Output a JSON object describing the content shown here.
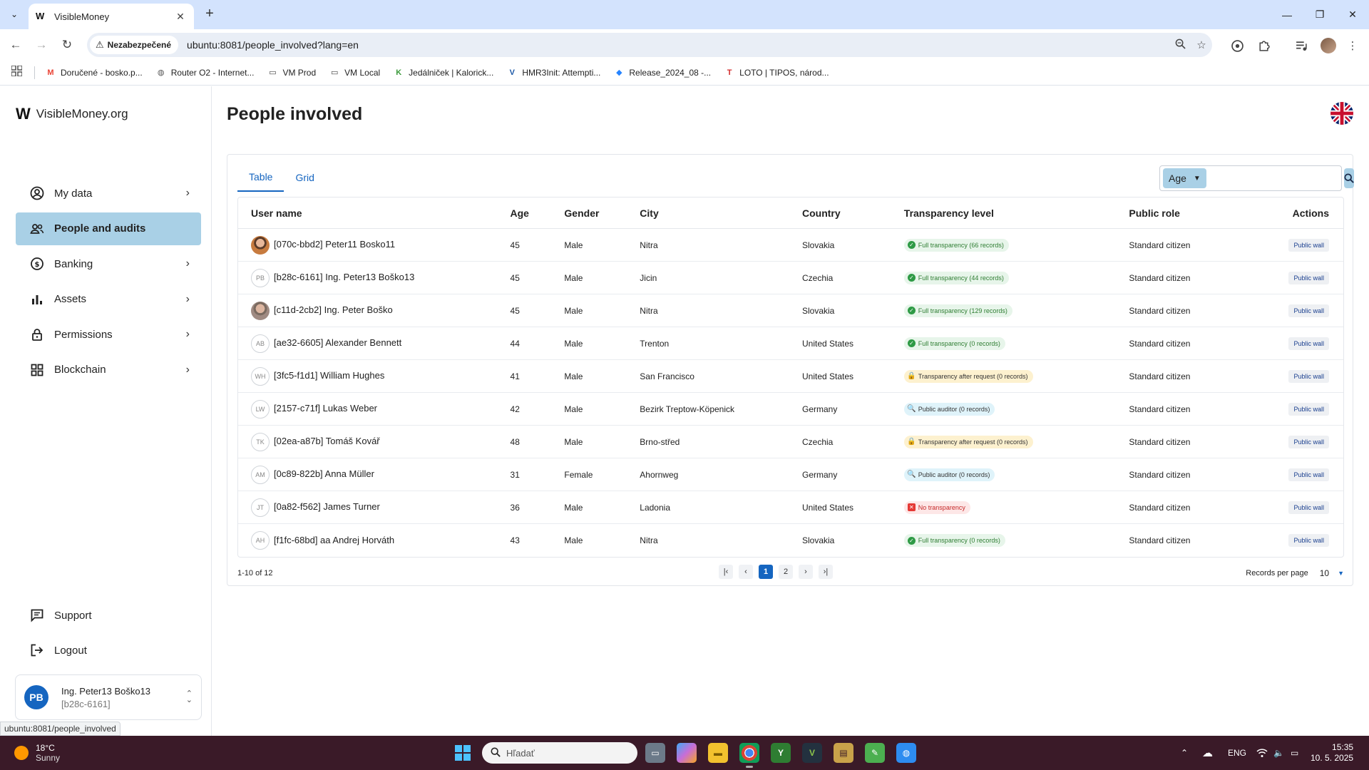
{
  "browser": {
    "tab_title": "VisibleMoney",
    "security_label": "Nezabezpečené",
    "url": "ubuntu:8081/people_involved?lang=en",
    "status_url": "ubuntu:8081/people_involved",
    "bookmarks": [
      {
        "label": "Doručené - bosko.p...",
        "icon": "gmail-icon",
        "color": "#ea4335"
      },
      {
        "label": "Router O2 - Internet...",
        "icon": "globe-icon",
        "color": "#555555"
      },
      {
        "label": "VM Prod",
        "icon": "folder-icon",
        "color": "#444444"
      },
      {
        "label": "VM Local",
        "icon": "folder-icon",
        "color": "#444444"
      },
      {
        "label": "Jedálniček | Kalorick...",
        "icon": "kaloricke-icon",
        "color": "#3c9a3c"
      },
      {
        "label": "HMR3Init: Attempti...",
        "icon": "virtualbox-icon",
        "color": "#1e5aa8"
      },
      {
        "label": "Release_2024_08 -...",
        "icon": "jira-icon",
        "color": "#2684ff"
      },
      {
        "label": "LOTO | TIPOS, národ...",
        "icon": "tipos-icon",
        "color": "#d32f2f"
      }
    ]
  },
  "app": {
    "brand": "VisibleMoney.org",
    "page_title": "People involved",
    "accent": "#1565c0",
    "active_bg": "#a9d0e6",
    "nav": [
      {
        "label": "My data",
        "icon": "account-circle-icon",
        "chevron": true
      },
      {
        "label": "People and audits",
        "icon": "people-icon",
        "chevron": false
      },
      {
        "label": "Banking",
        "icon": "banking-icon",
        "chevron": true
      },
      {
        "label": "Assets",
        "icon": "bar-chart-icon",
        "chevron": true
      },
      {
        "label": "Permissions",
        "icon": "lock-icon",
        "chevron": true
      },
      {
        "label": "Blockchain",
        "icon": "grid-icon",
        "chevron": true
      }
    ],
    "bottom_nav": [
      {
        "label": "Support",
        "icon": "support-chat-icon"
      },
      {
        "label": "Logout",
        "icon": "logout-icon"
      }
    ],
    "user": {
      "initials": "PB",
      "name": "Ing. Peter13 Boško13",
      "id": "[b28c-6161]"
    }
  },
  "view_tabs": [
    "Table",
    "Grid"
  ],
  "search": {
    "filter_field": "Age",
    "value": ""
  },
  "table": {
    "headers": [
      "User name",
      "Age",
      "Gender",
      "City",
      "Country",
      "Transparency level",
      "Public role",
      "Actions"
    ],
    "rows": [
      {
        "avatar": "photo1",
        "name": "[070c-bbd2] Peter11 Bosko11",
        "age": "45",
        "gender": "Male",
        "city": "Nitra",
        "country": "Slovakia",
        "badge_type": "full",
        "badge": "Full transparency (66 records)",
        "role": "Standard citizen",
        "action": "Public wall"
      },
      {
        "avatar": "PB",
        "name": "[b28c-6161] Ing. Peter13 Boško13",
        "age": "45",
        "gender": "Male",
        "city": "Jicin",
        "country": "Czechia",
        "badge_type": "full",
        "badge": "Full transparency (44 records)",
        "role": "Standard citizen",
        "action": "Public wall"
      },
      {
        "avatar": "photo2",
        "name": "[c11d-2cb2] Ing. Peter Boško",
        "age": "45",
        "gender": "Male",
        "city": "Nitra",
        "country": "Slovakia",
        "badge_type": "full",
        "badge": "Full transparency (129 records)",
        "role": "Standard citizen",
        "action": "Public wall"
      },
      {
        "avatar": "AB",
        "name": "[ae32-6605] Alexander Bennett",
        "age": "44",
        "gender": "Male",
        "city": "Trenton",
        "country": "United States",
        "badge_type": "full",
        "badge": "Full transparency (0 records)",
        "role": "Standard citizen",
        "action": "Public wall"
      },
      {
        "avatar": "WH",
        "name": "[3fc5-f1d1] William Hughes",
        "age": "41",
        "gender": "Male",
        "city": "San Francisco",
        "country": "United States",
        "badge_type": "request",
        "badge": "Transparency after request (0 records)",
        "role": "Standard citizen",
        "action": "Public wall"
      },
      {
        "avatar": "LW",
        "name": "[2157-c71f] Lukas Weber",
        "age": "42",
        "gender": "Male",
        "city": "Bezirk Treptow-Köpenick",
        "country": "Germany",
        "badge_type": "auditor",
        "badge": "Public auditor (0 records)",
        "role": "Standard citizen",
        "action": "Public wall"
      },
      {
        "avatar": "TK",
        "name": "[02ea-a87b] Tomáš Kovář",
        "age": "48",
        "gender": "Male",
        "city": "Brno-střed",
        "country": "Czechia",
        "badge_type": "request",
        "badge": "Transparency after request (0 records)",
        "role": "Standard citizen",
        "action": "Public wall"
      },
      {
        "avatar": "AM",
        "name": "[0c89-822b] Anna Müller",
        "age": "31",
        "gender": "Female",
        "city": "Ahornweg",
        "country": "Germany",
        "badge_type": "auditor",
        "badge": "Public auditor (0 records)",
        "role": "Standard citizen",
        "action": "Public wall"
      },
      {
        "avatar": "JT",
        "name": "[0a82-f562] James Turner",
        "age": "36",
        "gender": "Male",
        "city": "Ladonia",
        "country": "United States",
        "badge_type": "none",
        "badge": "No transparency",
        "role": "Standard citizen",
        "action": "Public wall"
      },
      {
        "avatar": "AH",
        "name": "[f1fc-68bd] aa Andrej Horváth",
        "age": "43",
        "gender": "Male",
        "city": "Nitra",
        "country": "Slovakia",
        "badge_type": "full",
        "badge": "Full transparency (0 records)",
        "role": "Standard citizen",
        "action": "Public wall"
      }
    ]
  },
  "pagination": {
    "range": "1-10 of 12",
    "pages": [
      "1",
      "2"
    ],
    "current": "1",
    "rpp_label": "Records per page",
    "rpp_value": "10"
  },
  "taskbar": {
    "weather_temp": "18°C",
    "weather_desc": "Sunny",
    "search_placeholder": "Hľadať",
    "lang": "ENG",
    "time": "15:35",
    "date": "10. 5. 2025"
  }
}
